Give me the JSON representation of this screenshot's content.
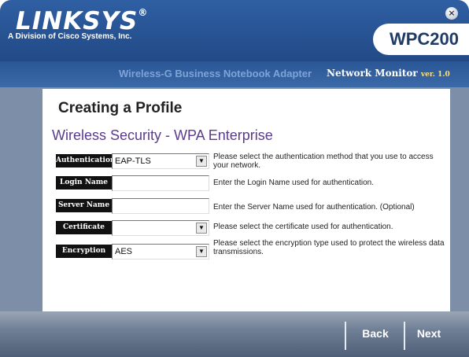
{
  "header": {
    "logo": "LINKSYS",
    "logo_mark": "®",
    "tagline": "A Division of Cisco Systems, Inc.",
    "close_glyph": "×",
    "model": "WPC200",
    "product": "Wireless-G Business Notebook Adapter",
    "monitor": "Network Monitor",
    "version": "ver. 1.0"
  },
  "main": {
    "page_title": "Creating a Profile",
    "section_title": "Wireless Security - WPA Enterprise",
    "fields": [
      {
        "label": "Authentication",
        "value": "EAP-TLS",
        "type": "dropdown",
        "help": "Please select the authentication method that you use to access your network."
      },
      {
        "label": "Login Name",
        "value": "",
        "type": "text",
        "help": "Enter the Login Name used for authentication."
      },
      {
        "label": "Server Name",
        "value": "",
        "type": "text",
        "help": "Enter the Server Name used for authentication. (Optional)"
      },
      {
        "label": "Certificate",
        "value": "",
        "type": "dropdown",
        "help": "Please select the certificate used for authentication."
      },
      {
        "label": "Encryption",
        "value": "AES",
        "type": "dropdown",
        "help": "Please select the encryption type used to protect the wireless data transmissions."
      }
    ],
    "dropdown_glyph": "▼"
  },
  "footer": {
    "back_label": "Back",
    "next_label": "Next"
  },
  "colors": {
    "header_blue": "#244e8c",
    "section_purple": "#5b3a8f",
    "label_black": "#111111",
    "footer_gray": "#6f7f96"
  }
}
